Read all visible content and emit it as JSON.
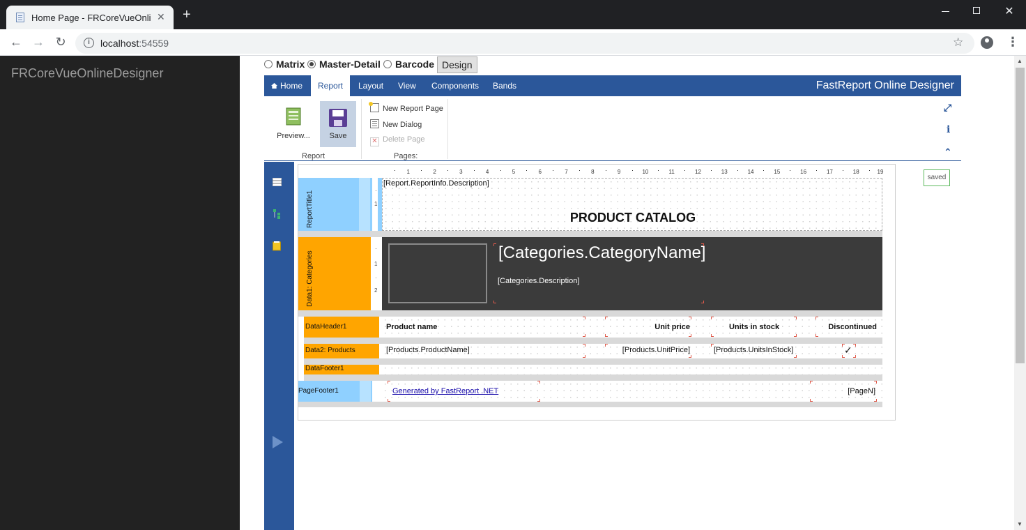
{
  "browser": {
    "tab_title": "Home Page - FRCoreVueOnlineD",
    "tab_close": "✕",
    "new_tab": "+",
    "url_host": "localhost",
    "url_port": ":54559",
    "info_icon": "i"
  },
  "sidebar": {
    "brand": "FRCoreVueOnlineDesigner"
  },
  "mode_selector": {
    "options": [
      {
        "label": "Matrix",
        "checked": false
      },
      {
        "label": "Master-Detail",
        "checked": true
      },
      {
        "label": "Barcode",
        "checked": false
      }
    ],
    "design_label": "Design"
  },
  "designer": {
    "tabs": [
      "Home",
      "Report",
      "Layout",
      "View",
      "Components",
      "Bands"
    ],
    "active_tab": "Report",
    "brand_title": "FastReport Online Designer",
    "ribbon": {
      "groups": {
        "report": "Report",
        "pages": "Pages:"
      },
      "preview_label": "Preview...",
      "save_label": "Save",
      "new_report_page": "New Report Page",
      "new_dialog": "New Dialog",
      "delete_page": "Delete Page"
    },
    "status": "saved",
    "ruler": [
      "1",
      "2",
      "3",
      "4",
      "5",
      "6",
      "7",
      "8",
      "9",
      "10",
      "11",
      "12",
      "13",
      "14",
      "15",
      "16",
      "17",
      "18",
      "19"
    ],
    "bands": {
      "report_title": {
        "label": "ReportTitle1",
        "field": "[Report.ReportInfo.Description]",
        "heading": "PRODUCT CATALOG",
        "ticks": [
          "·",
          "1"
        ]
      },
      "categories": {
        "label": "Data1: Categories",
        "name_field": "[Categories.CategoryName]",
        "desc_field": "[Categories.Description]",
        "ticks": [
          "·",
          "1",
          "·",
          "2"
        ]
      },
      "data_header": {
        "label": "DataHeader1",
        "columns": [
          "Product name",
          "Unit price",
          "Units in stock",
          "Discontinued"
        ]
      },
      "products": {
        "label": "Data2: Products",
        "cells": [
          "[Products.ProductName]",
          "[Products.UnitPrice]",
          "[Products.UnitsInStock]"
        ],
        "check": "✓"
      },
      "data_footer": {
        "label": "DataFooter1"
      },
      "page_footer": {
        "label": "PageFooter1",
        "link": "Generated by FastReport .NET",
        "page_n": "[PageN]"
      }
    }
  },
  "colors": {
    "accent": "#2b579a",
    "band_blue": "#8fd0ff",
    "band_orange": "#ffa500",
    "category_bg": "#3b3b3b",
    "sidebar_bg": "#222222"
  },
  "icons": {
    "back": "arrow-left-icon",
    "forward": "arrow-right-icon",
    "reload": "reload-icon",
    "star": "star-icon",
    "home": "home-icon",
    "fullscreen": "fullscreen-icon",
    "info": "info-icon",
    "collapse": "chevron-up-icon",
    "play": "play-icon"
  }
}
